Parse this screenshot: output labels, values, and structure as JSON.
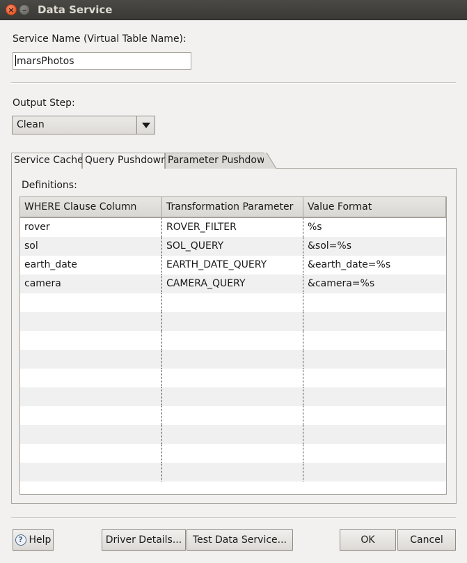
{
  "window": {
    "title": "Data Service"
  },
  "service_name": {
    "label": "Service Name (Virtual Table Name):",
    "value": "marsPhotos"
  },
  "output_step": {
    "label": "Output Step:",
    "value": "Clean"
  },
  "tabs": [
    {
      "label": "Service Cache",
      "active": false
    },
    {
      "label": "Query Pushdown",
      "active": false
    },
    {
      "label": "Parameter Pushdown",
      "active": true
    }
  ],
  "definitions": {
    "label": "Definitions:",
    "columns": [
      "WHERE Clause Column",
      "Transformation Parameter",
      "Value Format"
    ],
    "rows": [
      [
        "rover",
        "ROVER_FILTER",
        "%s"
      ],
      [
        "sol",
        "SOL_QUERY",
        "&sol=%s"
      ],
      [
        "earth_date",
        "EARTH_DATE_QUERY",
        "&earth_date=%s"
      ],
      [
        "camera",
        "CAMERA_QUERY",
        "&camera=%s"
      ]
    ]
  },
  "buttons": {
    "help": "Help",
    "driver_details": "Driver Details...",
    "test_data_service": "Test Data Service...",
    "ok": "OK",
    "cancel": "Cancel"
  },
  "icons": {
    "close": "close-icon",
    "minimize": "minimize-icon",
    "dropdown": "chevron-down-icon",
    "help": "help-icon"
  }
}
